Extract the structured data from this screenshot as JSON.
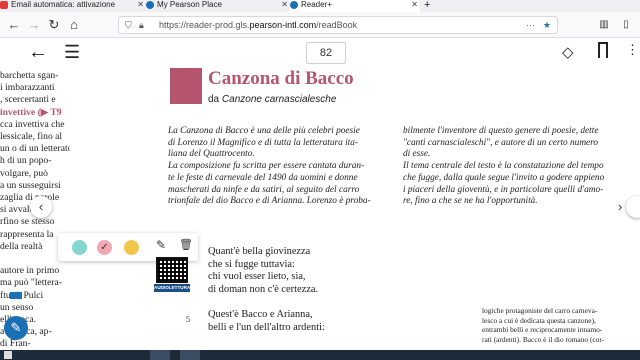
{
  "tabs": [
    {
      "label": "Email automatica: attivazione",
      "active": false
    },
    {
      "label": "My Pearson Place",
      "active": false
    },
    {
      "label": "Reader+",
      "active": true
    }
  ],
  "new_tab": "+",
  "url": {
    "prefix": "https://reader-prod.gls.",
    "domain": "pearson-intl.com",
    "suffix": "/readBook"
  },
  "page_number": "82",
  "title": "Canzona di Bacco",
  "subtitle_prefix": "da ",
  "subtitle_work": "Canzone carnascialesche",
  "left_column": [
    "barchetta sgan-",
    "i imbarazzanti",
    ", scercertanti e",
    "invettive (▶ T9",
    "cca invettiva che",
    "lessicale, fino al",
    "un o di un letterato",
    "h di un popo-",
    "volgare, può",
    "a un susseguirsi",
    "zaglia di parole",
    "si avvale in",
    "rfino se stesso",
    "rappresenta la",
    "della realtà",
    "",
    "autore in primo",
    "ma può \"lettera-",
    "ftutti, Pulci",
    "un senso",
    "ell'epoca.",
    "a di poca, ap-",
    "di Fran-"
  ],
  "intro_left": [
    "La Canzona di Bacco è una delle più celebri poesie",
    "di Lorenzo il Magnifico e di tutta la letteratura ita-",
    "liana del Quattrocento.",
    "La composizione fu scritta per essere cantata duran-",
    "te le feste di carnevale del 1490 da uomini e donne",
    "mascherati da ninfe e da satiri, al seguito del carro",
    "trionfale del dio Bacco e di Arianna. Lorenzo è proba-"
  ],
  "intro_right": [
    "bilmente l'inventore di questo genere di poesie, dette",
    "\"canti carnascialeschi\", e autore di un certo numero",
    "di esse.",
    "Il tema centrale del testo è la constatazione del tempo",
    "che fugge, dalla quale segue l'invito a godere appieno",
    "i piaceri della gioventù, e in particolare quelli d'amo-",
    "re, fino a che se ne ha l'opportunità."
  ],
  "poem": [
    "Quant'è bella giovinezza",
    "che si fugge tuttavia:",
    "chi vuol esser lieto, sia,",
    "di doman non c'è certezza.",
    "",
    "Quest'è Bacco e Arianna,",
    "belli e l'un dell'altro ardenti:"
  ],
  "poem_line_number": "5",
  "audio_label": "AUDIOLETTURA",
  "note_lines": [
    "logiche protagoniste del carro carneva-",
    "lesco a cui è dedicata questa canzone),",
    "entrambi belli e reciprocamente innamo-",
    "rati (ardenti). Bacco è il dio romano (cor-"
  ],
  "colors": {
    "title": "#b5566e",
    "title_block": "#b5566e",
    "swatch_teal": "#86d6cf",
    "swatch_pink": "#f2a7b3",
    "swatch_yellow": "#f2c54b",
    "accent": "#1a6fb5"
  }
}
